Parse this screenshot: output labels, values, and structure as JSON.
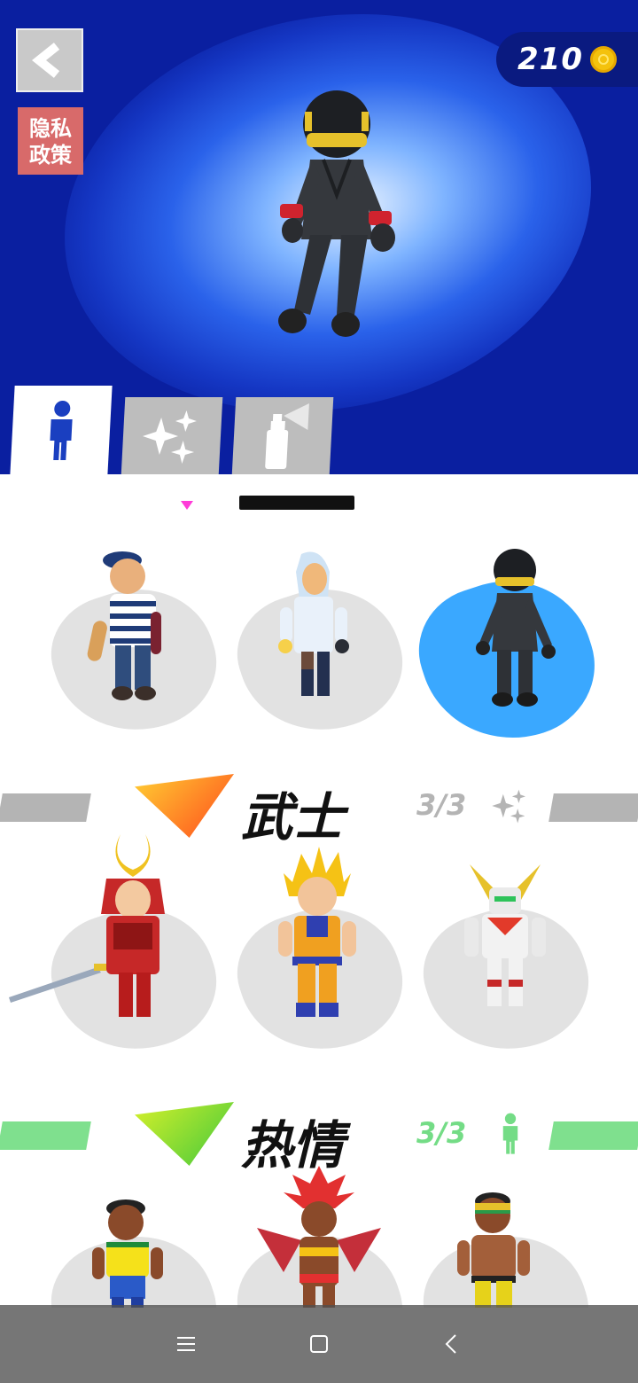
{
  "header": {
    "privacy_label": "隐私\n政策",
    "coins": "210"
  },
  "tabs": [
    {
      "name": "characters",
      "icon": "person-icon",
      "active": true
    },
    {
      "name": "effects",
      "icon": "sparkles-icon",
      "active": false
    },
    {
      "name": "spray",
      "icon": "spray-can-icon",
      "active": false
    }
  ],
  "sections": [
    {
      "title": "武士",
      "count": "3/3",
      "count_icon": "sparkles-icon",
      "bar_color": "#b4b4b4",
      "count_color": "#b4b4b4",
      "flag_gradient": [
        "#ffcf33",
        "#ff4a1c"
      ]
    },
    {
      "title": "热情",
      "count": "3/3",
      "count_icon": "person-icon",
      "bar_color": "#7fe08e",
      "count_color": "#74dc86",
      "flag_gradient": [
        "#d6f02a",
        "#41c83c"
      ]
    }
  ],
  "colors": {
    "hero_bg": "#0a1fa0",
    "selected_splash": "#3aa8ff",
    "privacy_bg": "#d86a6a"
  }
}
